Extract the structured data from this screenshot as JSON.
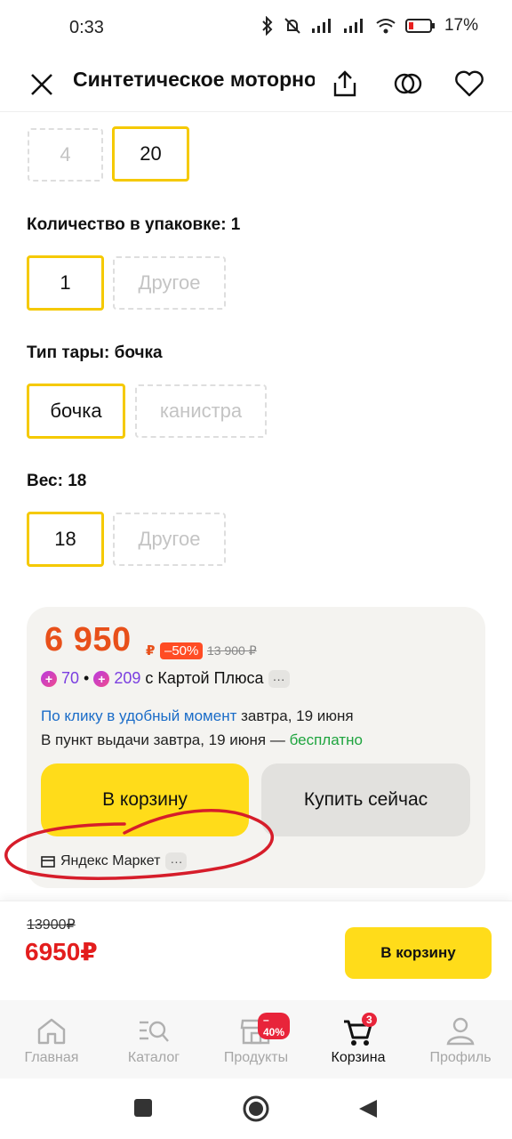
{
  "status": {
    "time": "0:33",
    "battery": "17%"
  },
  "header": {
    "title": "Синтетическое моторное масло",
    "close_icon": "close-icon",
    "share_icon": "share-icon",
    "compare_icon": "compare-icon",
    "favorite_icon": "heart-icon"
  },
  "options": {
    "volume": {
      "items": [
        "4",
        "20"
      ],
      "selected": "20"
    },
    "pack_qty": {
      "label": "Количество в упаковке: 1",
      "items": [
        "1",
        "Другое"
      ],
      "selected": "1"
    },
    "container": {
      "label": "Тип тары: бочка",
      "items": [
        "бочка",
        "канистра"
      ],
      "selected": "бочка"
    },
    "weight": {
      "label": "Вес: 18",
      "items": [
        "18",
        "Другое"
      ],
      "selected": "18"
    }
  },
  "offer": {
    "price": "6 950",
    "currency": "₽",
    "discount": "–50%",
    "old_price": "13 900 ₽",
    "plus_points": "70",
    "plus_points_card": "209",
    "plus_text": "с Картой Плюса",
    "more": "···",
    "delivery_link": "По клику в удобный момент",
    "delivery_date": " завтра, 19 июня",
    "pickup_text": "В пункт выдачи завтра, 19 июня — ",
    "pickup_free": "бесплатно",
    "cart_button": "В корзину",
    "buy_now_button": "Купить сейчас",
    "seller": "Яндекс Маркет"
  },
  "buy_bar": {
    "old_price": "13900₽",
    "price": "6950₽",
    "cart_button": "В корзину"
  },
  "bottom_nav": {
    "items": [
      {
        "label": "Главная",
        "icon": "home-icon"
      },
      {
        "label": "Каталог",
        "icon": "catalog-search-icon"
      },
      {
        "label": "Продукты",
        "icon": "store-icon",
        "badge": "–40%"
      },
      {
        "label": "Корзина",
        "icon": "cart-icon",
        "badge": "3",
        "active": true
      },
      {
        "label": "Профиль",
        "icon": "profile-icon"
      }
    ]
  },
  "colors": {
    "accent_yellow": "#ffdc1a",
    "price_orange": "#e8501a",
    "price_red": "#e31d1d",
    "annotation_red": "#d61d2a"
  }
}
